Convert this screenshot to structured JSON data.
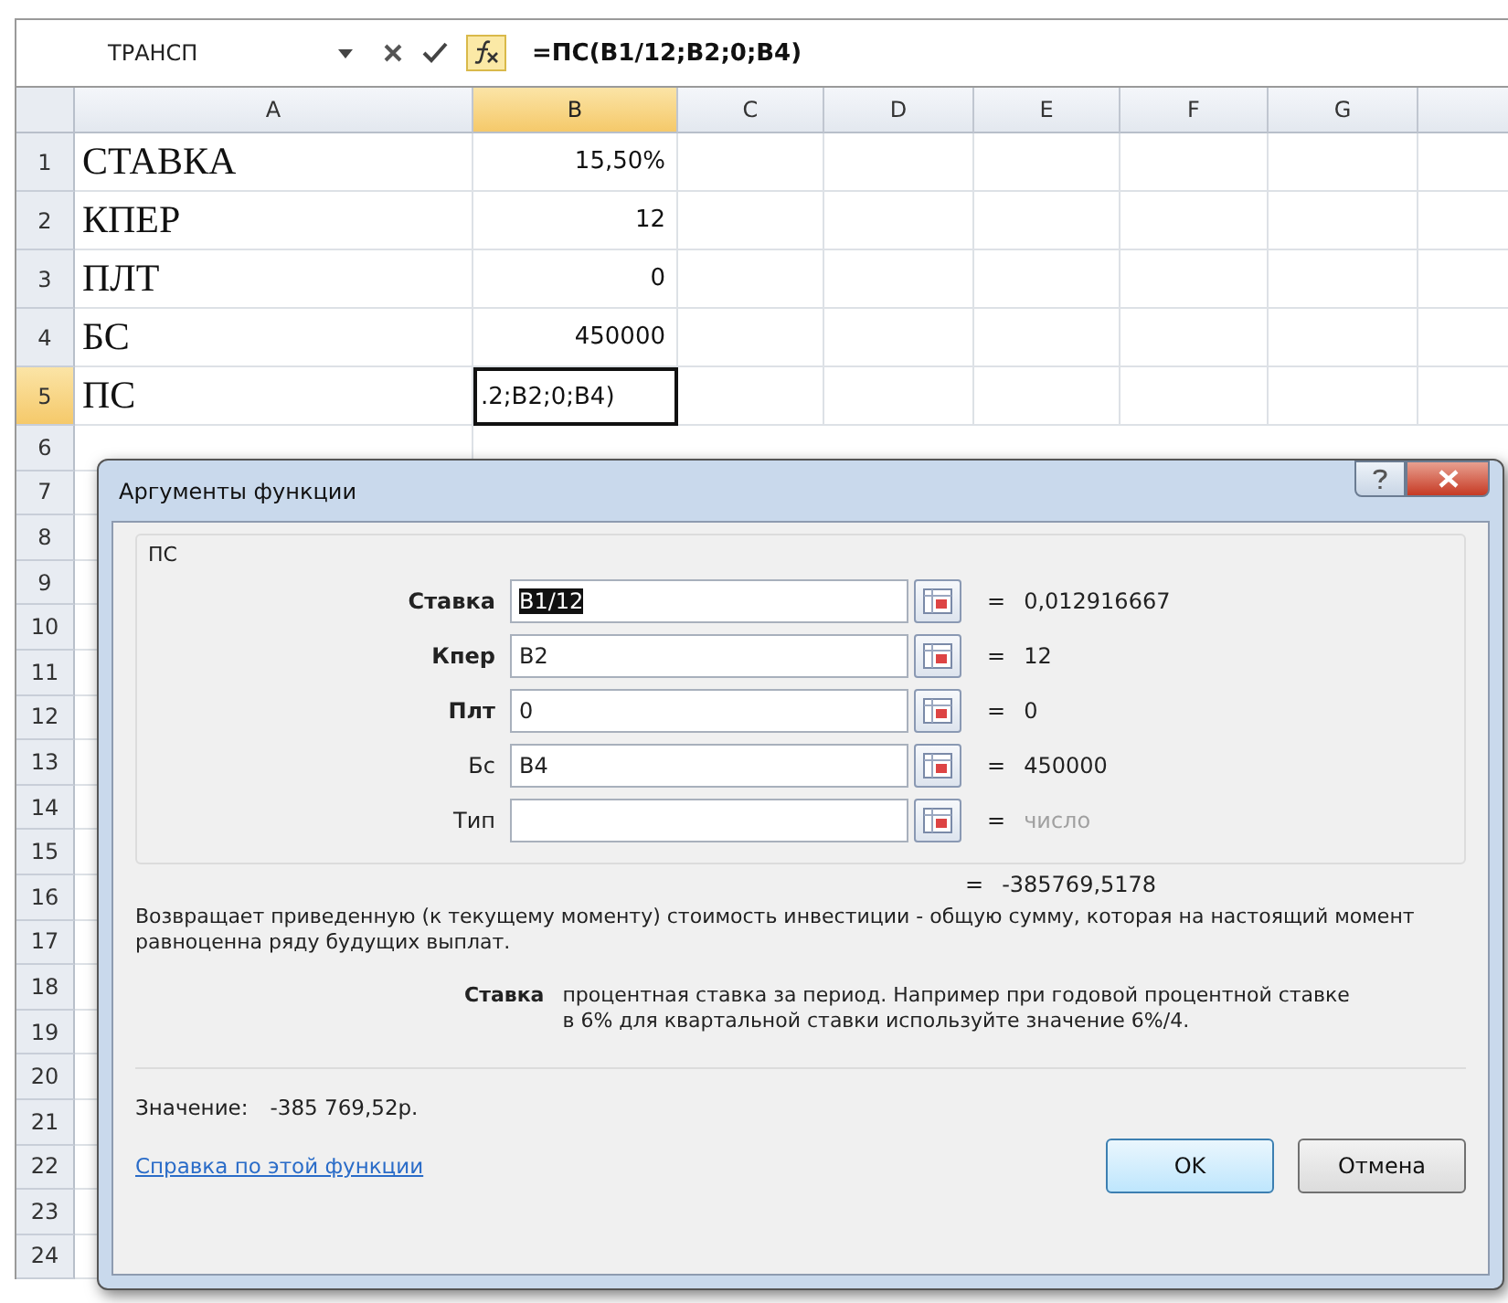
{
  "formula_bar": {
    "name_box": "ТРАНСП",
    "formula": "=ПС(B1/12;B2;0;B4)"
  },
  "columns": [
    {
      "label": "A",
      "selected": false
    },
    {
      "label": "B",
      "selected": true
    },
    {
      "label": "C",
      "selected": false
    },
    {
      "label": "D",
      "selected": false
    },
    {
      "label": "E",
      "selected": false
    },
    {
      "label": "F",
      "selected": false
    },
    {
      "label": "G",
      "selected": false
    }
  ],
  "rows": [
    {
      "number": "1",
      "selected": false,
      "cells": [
        "СТАВКА",
        "15,50%"
      ]
    },
    {
      "number": "2",
      "selected": false,
      "cells": [
        "КПЕР",
        "12"
      ]
    },
    {
      "number": "3",
      "selected": false,
      "cells": [
        "ПЛТ",
        "0"
      ]
    },
    {
      "number": "4",
      "selected": false,
      "cells": [
        "БС",
        "450000"
      ]
    },
    {
      "number": "5",
      "selected": true,
      "cells": [
        "ПС",
        ".2;B2;0;B4)"
      ]
    }
  ],
  "rows_below": [
    "6",
    "7",
    "8",
    "9",
    "10",
    "11",
    "12",
    "13",
    "14",
    "15",
    "16",
    "17",
    "18",
    "19",
    "20",
    "21",
    "22",
    "23",
    "24"
  ],
  "dialog": {
    "title": "Аргументы функции",
    "function_name": "ПС",
    "arguments": [
      {
        "label": "Ставка",
        "required": true,
        "value": "B1/12",
        "value_selected": true,
        "sign": "=",
        "result": "0,012916667",
        "hint": false
      },
      {
        "label": "Кпер",
        "required": true,
        "value": "B2",
        "value_selected": false,
        "sign": "=",
        "result": "12",
        "hint": false
      },
      {
        "label": "Плт",
        "required": true,
        "value": "0",
        "value_selected": false,
        "sign": "=",
        "result": "0",
        "hint": false
      },
      {
        "label": "Бс",
        "required": false,
        "value": "B4",
        "value_selected": false,
        "sign": "=",
        "result": "450000",
        "hint": false
      },
      {
        "label": "Тип",
        "required": false,
        "sign": "=",
        "result": "число",
        "hint": true
      }
    ],
    "formula_result_sign": "=",
    "formula_result": "-385769,5178",
    "description": "Возвращает приведенную (к текущему моменту) стоимость инвестиции - общую сумму, которая на настоящий момент равноценна ряду будущих выплат.",
    "argument_help": {
      "label": "Ставка",
      "text": "процентная ставка за период. Например при годовой процентной ставке в 6% для квартальной ставки используйте значение 6%/4."
    },
    "value_label": "Значение:",
    "value": "-385 769,52р.",
    "help_link": "Справка по этой функции",
    "buttons": [
      {
        "label": "OK",
        "default": true
      },
      {
        "label": "Отмена",
        "default": false
      }
    ]
  }
}
